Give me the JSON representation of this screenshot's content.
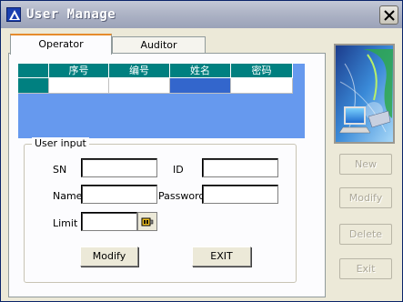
{
  "window": {
    "title": "User Manage",
    "close_label": "✕"
  },
  "tabs": [
    {
      "label": "Operator",
      "active": true
    },
    {
      "label": "Auditor",
      "active": false
    }
  ],
  "grid": {
    "columns": [
      "序号",
      "编号",
      "姓名",
      "密码"
    ],
    "rows": [
      [
        "",
        "",
        "",
        ""
      ]
    ]
  },
  "user_input": {
    "group_label": "User input",
    "sn_label": "SN",
    "sn_value": "",
    "id_label": "ID",
    "id_value": "",
    "name_label": "Name",
    "name_value": "",
    "password_label": "Password",
    "password_value": "",
    "limit_label": "Limit",
    "limit_value": "",
    "limit_icon": "key-icon"
  },
  "buttons": {
    "modify_label": "Modify",
    "exit_label": "EXIT"
  },
  "side_buttons": [
    "New",
    "Modify",
    "Delete",
    "Exit"
  ],
  "colors": {
    "grid_header": "#008080",
    "grid_background": "#6699ee",
    "selected_cell": "#3366cc",
    "tab_accent": "#e68b2c"
  },
  "logo_icon": "computer-network-logo"
}
